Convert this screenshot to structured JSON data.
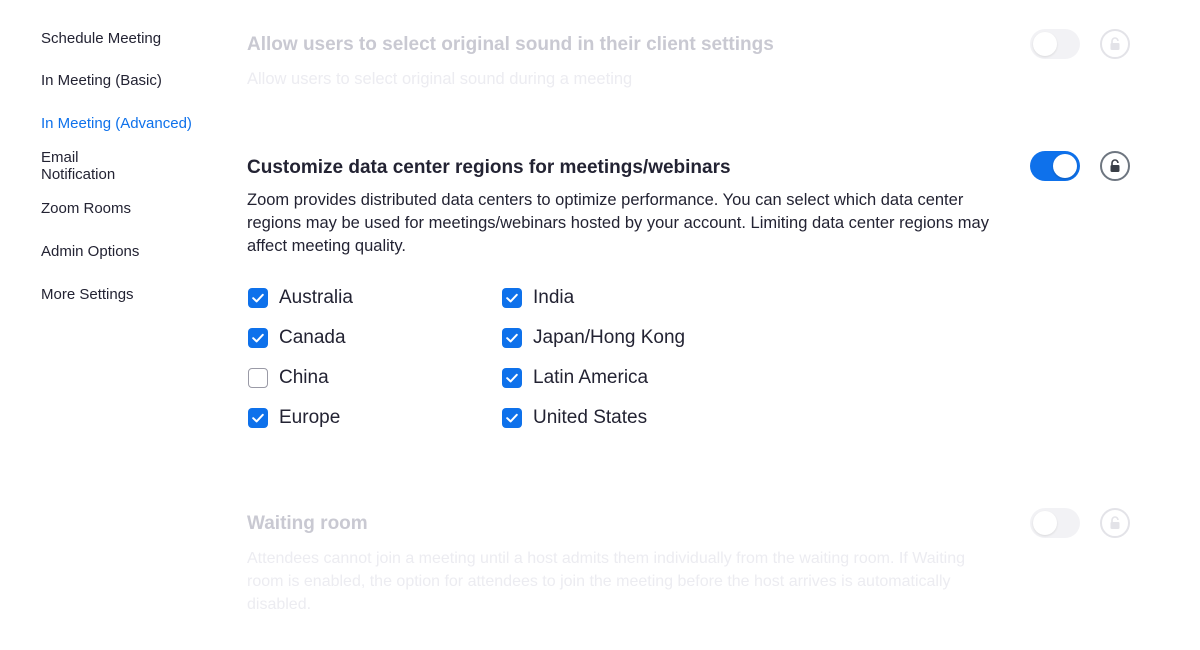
{
  "sidebar": {
    "items": [
      {
        "label": "Schedule Meeting",
        "active": false
      },
      {
        "label": "In Meeting (Basic)",
        "active": false
      },
      {
        "label": "In Meeting (Advanced)",
        "active": true
      },
      {
        "label": "Email\nNotification",
        "active": false
      },
      {
        "label": "Zoom Rooms",
        "active": false
      },
      {
        "label": "Admin Options",
        "active": false
      },
      {
        "label": "More Settings",
        "active": false
      }
    ]
  },
  "settings": {
    "original_sound": {
      "title": "Allow users to select original sound in their client settings",
      "description": "Allow users to select original sound during a meeting",
      "enabled": false
    },
    "data_center": {
      "title": "Customize data center regions for meetings/webinars",
      "description": "Zoom provides distributed data centers to optimize performance. You can select which data center regions may be used for meetings/webinars hosted by your account. Limiting data center regions may affect meeting quality.",
      "enabled": true,
      "regions": [
        {
          "label": "Australia",
          "checked": true
        },
        {
          "label": "Canada",
          "checked": true
        },
        {
          "label": "China",
          "checked": false
        },
        {
          "label": "Europe",
          "checked": true
        },
        {
          "label": "India",
          "checked": true
        },
        {
          "label": "Japan/Hong Kong",
          "checked": true
        },
        {
          "label": "Latin America",
          "checked": true
        },
        {
          "label": "United States",
          "checked": true
        }
      ]
    },
    "waiting_room": {
      "title": "Waiting room",
      "description": "Attendees cannot join a meeting until a host admits them individually from the waiting room. If Waiting room is enabled, the option for attendees to join the meeting before the host arrives is automatically disabled.",
      "enabled": false
    }
  },
  "colors": {
    "accent": "#0e71eb",
    "text": "#232333",
    "dim_title": "#c9c9d2"
  }
}
